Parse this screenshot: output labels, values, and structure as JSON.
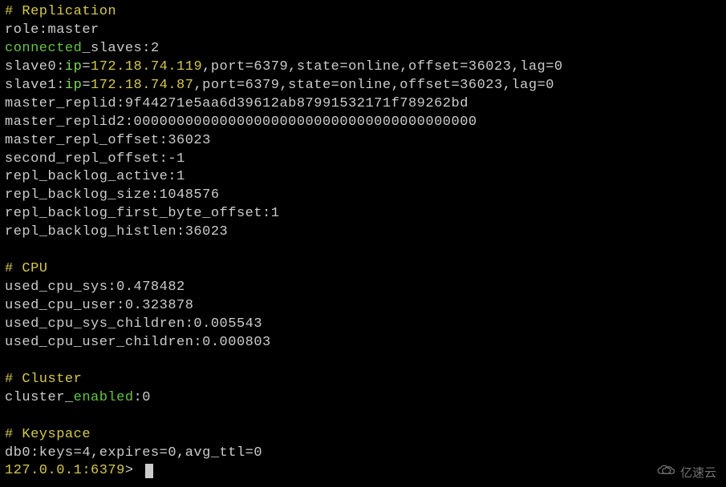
{
  "sections": {
    "replication": {
      "header": "# Replication",
      "role_key": "role:",
      "role_val": "master",
      "connected_word": "connected",
      "slaves_suffix": "_slaves:2",
      "slave0_prefix": "slave0:",
      "slave0_ipkey": "ip",
      "slave0_eq": "=",
      "slave0_ip": "172.18.74.119",
      "slave0_rest": ",port=6379,state=online,offset=36023,lag=0",
      "slave1_prefix": "slave1:",
      "slave1_ipkey": "ip",
      "slave1_eq": "=",
      "slave1_ip": "172.18.74.87",
      "slave1_rest": ",port=6379,state=online,offset=36023,lag=0",
      "master_replid": "master_replid:9f44271e5aa6d39612ab87991532171f789262bd",
      "master_replid2": "master_replid2:0000000000000000000000000000000000000000",
      "master_repl_offset": "master_repl_offset:36023",
      "second_repl_offset": "second_repl_offset:-1",
      "repl_backlog_active": "repl_backlog_active:1",
      "repl_backlog_size": "repl_backlog_size:1048576",
      "repl_backlog_first_byte_offset": "repl_backlog_first_byte_offset:1",
      "repl_backlog_histlen": "repl_backlog_histlen:36023"
    },
    "cpu": {
      "header": "# CPU",
      "used_cpu_sys": "used_cpu_sys:0.478482",
      "used_cpu_user": "used_cpu_user:0.323878",
      "used_cpu_sys_children": "used_cpu_sys_children:0.005543",
      "used_cpu_user_children": "used_cpu_user_children:0.000803"
    },
    "cluster": {
      "header": "# Cluster",
      "cluster_prefix": "cluster_",
      "cluster_word": "enabled",
      "cluster_suffix": ":0"
    },
    "keyspace": {
      "header": "# Keyspace",
      "db0": "db0:keys=4,expires=0,avg_ttl=0"
    }
  },
  "prompt": {
    "host": "127.0.0.1:",
    "port": "6379",
    "gt": "> "
  },
  "watermark": "亿速云"
}
